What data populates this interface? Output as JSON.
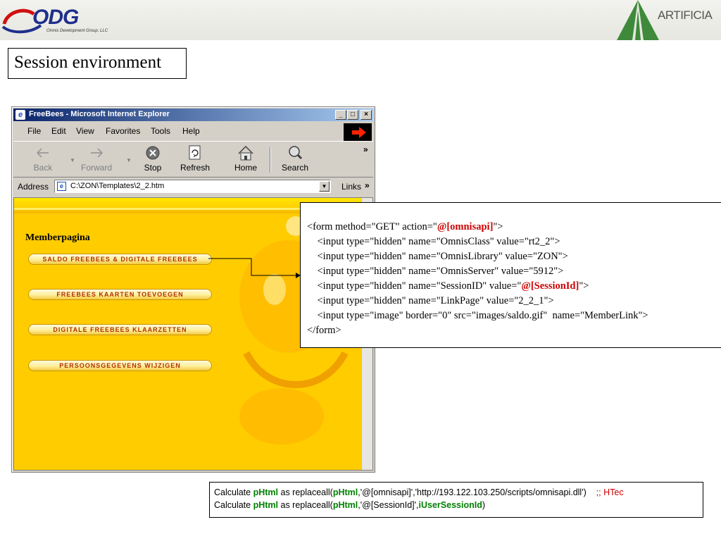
{
  "header": {
    "left_logo": {
      "text": "ODG",
      "subtitle": "Omnis Development Group, LLC"
    },
    "right_logo": {
      "text": "ARTIFICIA"
    }
  },
  "slide_title": "Session environment",
  "browser": {
    "title": "FreeBees - Microsoft Internet Explorer",
    "window_buttons": [
      "_",
      "□",
      "×"
    ],
    "menu": [
      "File",
      "Edit",
      "View",
      "Favorites",
      "Tools",
      "Help"
    ],
    "toolbar": [
      {
        "label": "Back",
        "icon": "back-arrow-icon",
        "enabled": false
      },
      {
        "label": "Forward",
        "icon": "forward-arrow-icon",
        "enabled": false
      },
      {
        "label": "Stop",
        "icon": "stop-icon",
        "enabled": true
      },
      {
        "label": "Refresh",
        "icon": "refresh-icon",
        "enabled": true
      },
      {
        "label": "Home",
        "icon": "home-icon",
        "enabled": true
      },
      {
        "label": "Search",
        "icon": "search-icon",
        "enabled": true
      }
    ],
    "chevron": "»",
    "address_label": "Address",
    "address_url": "C:\\ZON\\Templates\\2_2.htm",
    "links_label": "Links",
    "page": {
      "heading": "Memberpagina",
      "buttons": [
        "SALDO FREEBEES & DIGITALE FREEBEES",
        "FREEBEES KAARTEN TOEVOEGEN",
        "DIGITALE FREEBEES KLAARZETTEN",
        "PERSOONSGEGEVENS WIJZIGEN"
      ]
    }
  },
  "code_box": {
    "lines": [
      {
        "pre": "<form method=\"GET\" action=\"",
        "hl": "@[omnisapi]",
        "post": "\">"
      },
      {
        "pre": "    <input type=\"hidden\" name=\"OmnisClass\" value=\"rt2_2\">",
        "hl": "",
        "post": ""
      },
      {
        "pre": "    <input type=\"hidden\" name=\"OmnisLibrary\" value=\"ZON\">",
        "hl": "",
        "post": ""
      },
      {
        "pre": "    <input type=\"hidden\" name=\"OmnisServer\" value=\"5912\">",
        "hl": "",
        "post": ""
      },
      {
        "pre": "    <input type=\"hidden\" name=\"SessionID\" value=\"",
        "hl": "@[SessionId]",
        "post": "\">"
      },
      {
        "pre": "    <input type=\"hidden\" name=\"LinkPage\" value=\"2_2_1\">",
        "hl": "",
        "post": ""
      },
      {
        "pre": "    <input type=\"image\" border=\"0\" src=\"images/saldo.gif\"  name=\"MemberLink\">",
        "hl": "",
        "post": ""
      },
      {
        "pre": "</form>",
        "hl": "",
        "post": ""
      }
    ]
  },
  "calc_box": {
    "line1": {
      "kw": "Calculate ",
      "var": "pHtml",
      "mid": " as replaceall(",
      "var2": "pHtml",
      "args": ",'@[omnisapi]','http://193.122.103.250/scripts/omnisapi.dll')",
      "comment": ";; HTec"
    },
    "line2": {
      "kw": "Calculate ",
      "var": "pHtml",
      "mid": " as replaceall(",
      "var2": "pHtml",
      "args": ",'@[SessionId]',",
      "var3": "iUserSessionId",
      "end": ")"
    }
  },
  "colors": {
    "highlight_red": "#cc0000",
    "variable_green": "#008000",
    "page_yellow": "#ffcc00",
    "button_text": "#b03000",
    "ie_title_blue": "#0a246a"
  }
}
